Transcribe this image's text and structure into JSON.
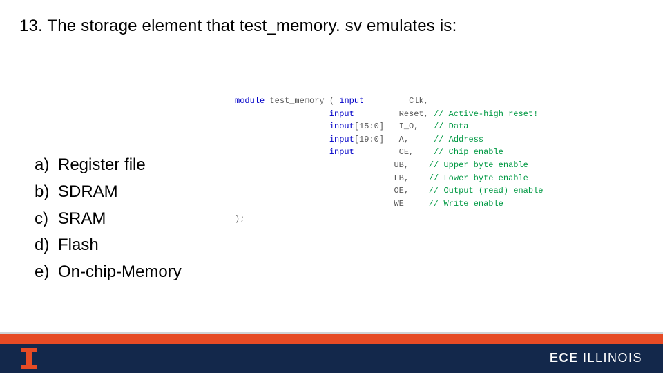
{
  "question": "13. The storage element that test_memory. sv emulates is:",
  "options": [
    {
      "letter": "a)",
      "text": "Register file"
    },
    {
      "letter": "b)",
      "text": "SDRAM"
    },
    {
      "letter": "c)",
      "text": "SRAM"
    },
    {
      "letter": "d)",
      "text": "Flash"
    },
    {
      "letter": "e)",
      "text": "On-chip-Memory"
    }
  ],
  "code": {
    "kw_module": "module",
    "kw_input0": "input",
    "kw_input1": "input",
    "kw_inout": "inout",
    "kw_input2": "input",
    "kw_input3": "input",
    "name": " test_memory ( ",
    "sig_clk": "Clk,",
    "sig_reset": "Reset, ",
    "sig_io": "I_O,   ",
    "sig_a": "A,     ",
    "sig_ce": "CE,    ",
    "sig_ub": "UB,    ",
    "sig_lb": "LB,    ",
    "sig_oe": "OE,    ",
    "sig_we": "WE     ",
    "col2_pad": "                   ",
    "col3_pad": "                                ",
    "r15": "[15:0]   ",
    "r19": "[19:0]   ",
    "r_blank": "         ",
    "c_reset": "// Active-high reset!",
    "c_data": "// Data",
    "c_addr": "// Address",
    "c_ce": "// Chip enable",
    "c_ub": "// Upper byte enable",
    "c_lb": "// Lower byte enable",
    "c_oe": "// Output (read) enable",
    "c_we": "// Write enable",
    "close": ");"
  },
  "footer": {
    "brand": "ECE ",
    "brand2": "ILLINOIS"
  }
}
